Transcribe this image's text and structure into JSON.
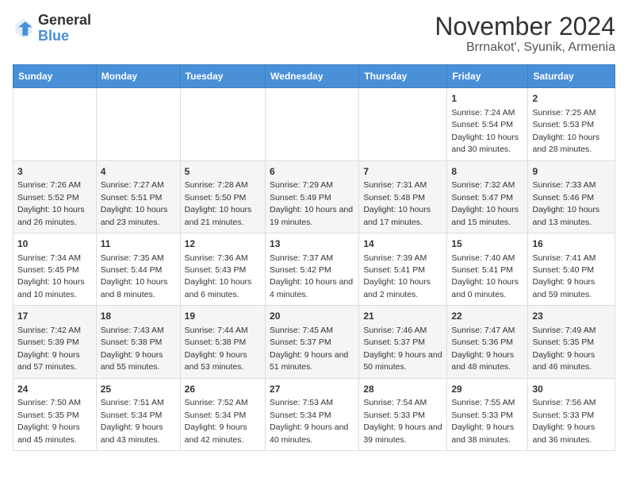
{
  "logo": {
    "general": "General",
    "blue": "Blue"
  },
  "title": "November 2024",
  "subtitle": "Brrnakot', Syunik, Armenia",
  "days_of_week": [
    "Sunday",
    "Monday",
    "Tuesday",
    "Wednesday",
    "Thursday",
    "Friday",
    "Saturday"
  ],
  "weeks": [
    [
      {
        "day": "",
        "info": ""
      },
      {
        "day": "",
        "info": ""
      },
      {
        "day": "",
        "info": ""
      },
      {
        "day": "",
        "info": ""
      },
      {
        "day": "",
        "info": ""
      },
      {
        "day": "1",
        "info": "Sunrise: 7:24 AM\nSunset: 5:54 PM\nDaylight: 10 hours and 30 minutes."
      },
      {
        "day": "2",
        "info": "Sunrise: 7:25 AM\nSunset: 5:53 PM\nDaylight: 10 hours and 28 minutes."
      }
    ],
    [
      {
        "day": "3",
        "info": "Sunrise: 7:26 AM\nSunset: 5:52 PM\nDaylight: 10 hours and 26 minutes."
      },
      {
        "day": "4",
        "info": "Sunrise: 7:27 AM\nSunset: 5:51 PM\nDaylight: 10 hours and 23 minutes."
      },
      {
        "day": "5",
        "info": "Sunrise: 7:28 AM\nSunset: 5:50 PM\nDaylight: 10 hours and 21 minutes."
      },
      {
        "day": "6",
        "info": "Sunrise: 7:29 AM\nSunset: 5:49 PM\nDaylight: 10 hours and 19 minutes."
      },
      {
        "day": "7",
        "info": "Sunrise: 7:31 AM\nSunset: 5:48 PM\nDaylight: 10 hours and 17 minutes."
      },
      {
        "day": "8",
        "info": "Sunrise: 7:32 AM\nSunset: 5:47 PM\nDaylight: 10 hours and 15 minutes."
      },
      {
        "day": "9",
        "info": "Sunrise: 7:33 AM\nSunset: 5:46 PM\nDaylight: 10 hours and 13 minutes."
      }
    ],
    [
      {
        "day": "10",
        "info": "Sunrise: 7:34 AM\nSunset: 5:45 PM\nDaylight: 10 hours and 10 minutes."
      },
      {
        "day": "11",
        "info": "Sunrise: 7:35 AM\nSunset: 5:44 PM\nDaylight: 10 hours and 8 minutes."
      },
      {
        "day": "12",
        "info": "Sunrise: 7:36 AM\nSunset: 5:43 PM\nDaylight: 10 hours and 6 minutes."
      },
      {
        "day": "13",
        "info": "Sunrise: 7:37 AM\nSunset: 5:42 PM\nDaylight: 10 hours and 4 minutes."
      },
      {
        "day": "14",
        "info": "Sunrise: 7:39 AM\nSunset: 5:41 PM\nDaylight: 10 hours and 2 minutes."
      },
      {
        "day": "15",
        "info": "Sunrise: 7:40 AM\nSunset: 5:41 PM\nDaylight: 10 hours and 0 minutes."
      },
      {
        "day": "16",
        "info": "Sunrise: 7:41 AM\nSunset: 5:40 PM\nDaylight: 9 hours and 59 minutes."
      }
    ],
    [
      {
        "day": "17",
        "info": "Sunrise: 7:42 AM\nSunset: 5:39 PM\nDaylight: 9 hours and 57 minutes."
      },
      {
        "day": "18",
        "info": "Sunrise: 7:43 AM\nSunset: 5:38 PM\nDaylight: 9 hours and 55 minutes."
      },
      {
        "day": "19",
        "info": "Sunrise: 7:44 AM\nSunset: 5:38 PM\nDaylight: 9 hours and 53 minutes."
      },
      {
        "day": "20",
        "info": "Sunrise: 7:45 AM\nSunset: 5:37 PM\nDaylight: 9 hours and 51 minutes."
      },
      {
        "day": "21",
        "info": "Sunrise: 7:46 AM\nSunset: 5:37 PM\nDaylight: 9 hours and 50 minutes."
      },
      {
        "day": "22",
        "info": "Sunrise: 7:47 AM\nSunset: 5:36 PM\nDaylight: 9 hours and 48 minutes."
      },
      {
        "day": "23",
        "info": "Sunrise: 7:49 AM\nSunset: 5:35 PM\nDaylight: 9 hours and 46 minutes."
      }
    ],
    [
      {
        "day": "24",
        "info": "Sunrise: 7:50 AM\nSunset: 5:35 PM\nDaylight: 9 hours and 45 minutes."
      },
      {
        "day": "25",
        "info": "Sunrise: 7:51 AM\nSunset: 5:34 PM\nDaylight: 9 hours and 43 minutes."
      },
      {
        "day": "26",
        "info": "Sunrise: 7:52 AM\nSunset: 5:34 PM\nDaylight: 9 hours and 42 minutes."
      },
      {
        "day": "27",
        "info": "Sunrise: 7:53 AM\nSunset: 5:34 PM\nDaylight: 9 hours and 40 minutes."
      },
      {
        "day": "28",
        "info": "Sunrise: 7:54 AM\nSunset: 5:33 PM\nDaylight: 9 hours and 39 minutes."
      },
      {
        "day": "29",
        "info": "Sunrise: 7:55 AM\nSunset: 5:33 PM\nDaylight: 9 hours and 38 minutes."
      },
      {
        "day": "30",
        "info": "Sunrise: 7:56 AM\nSunset: 5:33 PM\nDaylight: 9 hours and 36 minutes."
      }
    ]
  ]
}
